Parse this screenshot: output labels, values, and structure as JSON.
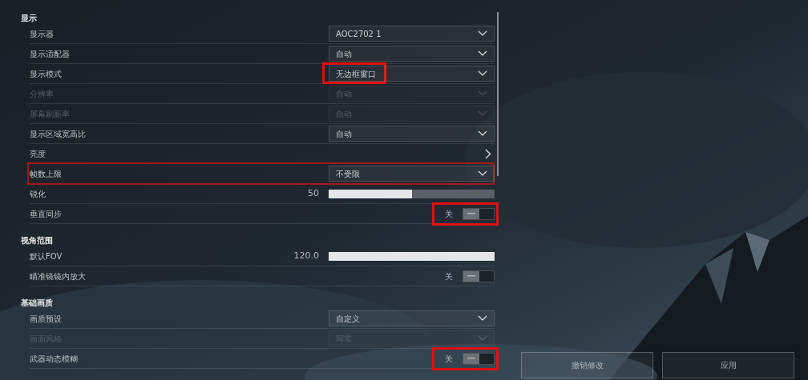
{
  "sections": [
    {
      "title": "显示",
      "rows": [
        {
          "kind": "dropdown",
          "label": "显示器",
          "value": "AOC2702 1",
          "disabled": false
        },
        {
          "kind": "dropdown",
          "label": "显示适配器",
          "value": "自动",
          "disabled": false
        },
        {
          "kind": "dropdown",
          "label": "显示模式",
          "value": "无边框窗口",
          "disabled": false,
          "value_highlighted": true
        },
        {
          "kind": "dropdown",
          "label": "分辨率",
          "value": "自动",
          "disabled": true
        },
        {
          "kind": "dropdown",
          "label": "屏幕刷新率",
          "value": "自动",
          "disabled": true
        },
        {
          "kind": "dropdown",
          "label": "显示区域宽高比",
          "value": "自动",
          "disabled": false
        },
        {
          "kind": "link",
          "label": "亮度",
          "disabled": false
        },
        {
          "kind": "dropdown",
          "label": "帧数上限",
          "value": "不受限",
          "disabled": false,
          "highlighted": true
        },
        {
          "kind": "slider",
          "label": "锐化",
          "reading": "50",
          "level": 0.5,
          "disabled": false
        },
        {
          "kind": "toggle",
          "label": "垂直同步",
          "state_text": "关",
          "on": false,
          "disabled": false,
          "toggle_highlighted": true
        }
      ]
    },
    {
      "title": "视角范围",
      "rows": [
        {
          "kind": "slider",
          "label": "默认FOV",
          "reading": "120.0",
          "level": 1,
          "disabled": false
        },
        {
          "kind": "toggle",
          "label": "瞄准镜镜内放大",
          "state_text": "关",
          "on": false,
          "disabled": false
        }
      ]
    },
    {
      "title": "基础画质",
      "rows": [
        {
          "kind": "dropdown",
          "label": "画质预设",
          "value": "自定义",
          "disabled": false
        },
        {
          "kind": "dropdown",
          "label": "画面风格",
          "value": "写实",
          "disabled": true
        },
        {
          "kind": "toggle",
          "label": "武器动态模糊",
          "state_text": "关",
          "on": false,
          "disabled": false,
          "toggle_highlighted": true
        }
      ]
    }
  ],
  "buttons": [
    {
      "label": "撤销修改"
    },
    {
      "label": "应用"
    }
  ]
}
